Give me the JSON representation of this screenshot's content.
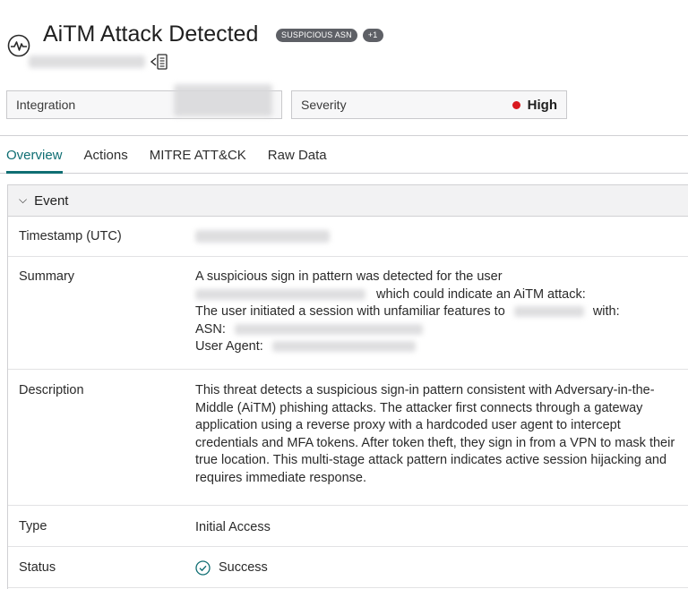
{
  "header": {
    "title": "AiTM Attack Detected",
    "badges": [
      "SUSPICIOUS ASN",
      "+1"
    ],
    "icon": "activity-pulse-icon",
    "subtitle_icon": "copy-to-clipboard-icon"
  },
  "filters": {
    "integration_label": "Integration",
    "severity_label": "Severity",
    "severity_value": "High",
    "severity_color": "#d9191f"
  },
  "tabs": [
    {
      "label": "Overview",
      "active": true
    },
    {
      "label": "Actions",
      "active": false
    },
    {
      "label": "MITRE ATT&CK",
      "active": false
    },
    {
      "label": "Raw Data",
      "active": false
    }
  ],
  "accent_color": "#0f6e73",
  "event": {
    "section_title": "Event",
    "rows": {
      "timestamp_label": "Timestamp (UTC)",
      "summary_label": "Summary",
      "summary_line1": "A suspicious sign in pattern was detected for the user",
      "summary_line2_tail": "which could indicate an AiTM attack:",
      "summary_line3_head": "The user initiated a session with unfamiliar features to",
      "summary_line3_tail": "with:",
      "summary_asn": "ASN:",
      "summary_user_agent": "User Agent:",
      "description_label": "Description",
      "description_text": "This threat detects a suspicious sign-in pattern consistent with Adversary-in-the-Middle (AiTM) phishing attacks. The attacker first connects through a gateway application using a reverse proxy with a hardcoded user agent to intercept credentials and MFA tokens. After token theft, they sign in from a VPN to mask their true location. This multi-stage attack pattern indicates active session hijacking and requires immediate response.",
      "type_label": "Type",
      "type_value": "Initial Access",
      "status_label": "Status",
      "status_value": "Success"
    }
  }
}
